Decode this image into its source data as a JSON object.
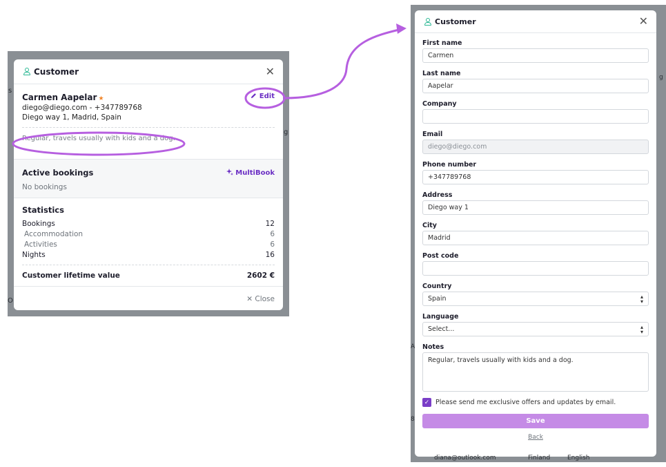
{
  "left_modal": {
    "title": "Customer",
    "customer": {
      "name": "Carmen Aapelar",
      "star": "★",
      "contact": "diego@diego.com - +347789768",
      "address": "Diego way 1, Madrid, Spain",
      "notes": "Regular, travels usually with kids and a dog."
    },
    "edit_label": "Edit",
    "close_icon": "✕",
    "active_bookings": {
      "title": "Active bookings",
      "empty": "No bookings",
      "multibook_label": "MultiBook"
    },
    "statistics": {
      "title": "Statistics",
      "rows": [
        {
          "label": "Bookings",
          "value": "12"
        },
        {
          "label": "Accommodation",
          "value": "6"
        },
        {
          "label": "Activities",
          "value": "6"
        },
        {
          "label": "Nights",
          "value": "16"
        }
      ],
      "ltv_label": "Customer lifetime value",
      "ltv_value": "2602 €"
    },
    "footer_close": "✕ Close"
  },
  "right_modal": {
    "title": "Customer",
    "close_icon": "✕",
    "fields": {
      "first_name": {
        "label": "First name",
        "value": "Carmen"
      },
      "last_name": {
        "label": "Last name",
        "value": "Aapelar"
      },
      "company": {
        "label": "Company",
        "value": ""
      },
      "email": {
        "label": "Email",
        "value": "diego@diego.com"
      },
      "phone": {
        "label": "Phone number",
        "value": "+347789768"
      },
      "address": {
        "label": "Address",
        "value": "Diego way 1"
      },
      "city": {
        "label": "City",
        "value": "Madrid"
      },
      "post_code": {
        "label": "Post code",
        "value": ""
      },
      "country": {
        "label": "Country",
        "value": "Spain"
      },
      "language": {
        "label": "Language",
        "value": "Select..."
      },
      "notes": {
        "label": "Notes",
        "value": "Regular, travels usually with kids and a dog."
      }
    },
    "consent_label": "Please send me exclusive offers and updates by email.",
    "consent_checked": true,
    "save_label": "Save",
    "back_label": "Back"
  },
  "background_fragments": {
    "bottom_row": {
      "email": "diana@outlook.com",
      "country": "Finland",
      "language": "English"
    }
  },
  "colors": {
    "accent": "#6b2fc4",
    "save_button": "#c58be6",
    "annotation": "#b65fe0",
    "star": "#f1862b",
    "person_icon": "#2bb894",
    "backdrop": "#8a8f94"
  }
}
